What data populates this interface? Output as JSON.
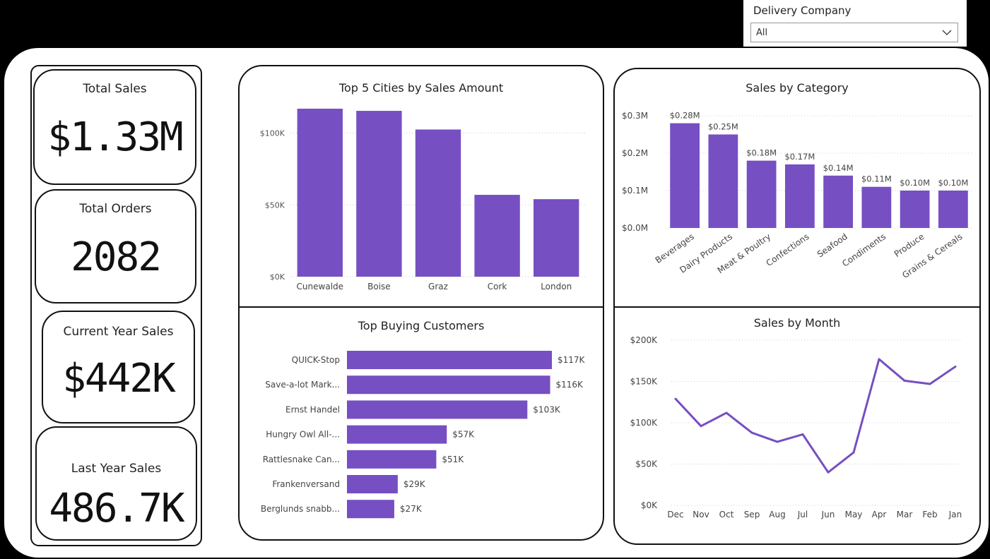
{
  "slicer": {
    "title": "Delivery Company",
    "value": "All"
  },
  "kpis": {
    "total_sales": {
      "label": "Total Sales",
      "value": "$1.33M"
    },
    "total_orders": {
      "label": "Total Orders",
      "value": "2082"
    },
    "current_year_sales": {
      "label": "Current Year Sales",
      "value": "$442K"
    },
    "last_year_sales": {
      "label": "Last Year Sales",
      "value": "486.7K"
    }
  },
  "colors": {
    "accent": "#764FC3"
  },
  "chart_data": [
    {
      "id": "cities",
      "type": "bar",
      "title": "Top 5 Cities by Sales Amount",
      "categories": [
        "Cunewalde",
        "Boise",
        "Graz",
        "Cork",
        "London"
      ],
      "values": [
        117,
        115.5,
        102.5,
        57,
        54
      ],
      "ylim": [
        0,
        117
      ],
      "yticks": [
        0,
        50,
        100
      ],
      "ytick_labels": [
        "$0K",
        "$50K",
        "$100K"
      ],
      "grid": true
    },
    {
      "id": "categories",
      "type": "bar",
      "title": "Sales by Category",
      "categories": [
        "Beverages",
        "Dairy Products",
        "Meat & Poultry",
        "Confections",
        "Seafood",
        "Condiments",
        "Produce",
        "Grains & Cereals"
      ],
      "values": [
        0.28,
        0.25,
        0.18,
        0.17,
        0.14,
        0.11,
        0.1,
        0.1
      ],
      "data_labels": [
        "$0.28M",
        "$0.25M",
        "$0.18M",
        "$0.17M",
        "$0.14M",
        "$0.11M",
        "$0.10M",
        "$0.10M"
      ],
      "ylim": [
        0,
        0.3
      ],
      "yticks": [
        0,
        0.1,
        0.2,
        0.3
      ],
      "ytick_labels": [
        "$0.0M",
        "$0.1M",
        "$0.2M",
        "$0.3M"
      ],
      "grid": true
    },
    {
      "id": "customers",
      "type": "bar",
      "orientation": "horizontal",
      "title": "Top Buying Customers",
      "categories": [
        "QUICK-Stop",
        "Save-a-lot Mark...",
        "Ernst Handel",
        "Hungry Owl All-...",
        "Rattlesnake Can...",
        "Frankenversand",
        "Berglunds snabb..."
      ],
      "values": [
        117,
        116,
        103,
        57,
        51,
        29,
        27
      ],
      "data_labels": [
        "$117K",
        "$116K",
        "$103K",
        "$57K",
        "$51K",
        "$29K",
        "$27K"
      ],
      "xlim": [
        0,
        117
      ]
    },
    {
      "id": "months",
      "type": "line",
      "title": "Sales by Month",
      "x": [
        "Dec",
        "Nov",
        "Oct",
        "Sep",
        "Aug",
        "Jul",
        "Jun",
        "May",
        "Apr",
        "Mar",
        "Feb",
        "Jan"
      ],
      "values": [
        129,
        96,
        112,
        88,
        77,
        86,
        40,
        64,
        177,
        151,
        147,
        168
      ],
      "ylim": [
        0,
        200
      ],
      "yticks": [
        0,
        50,
        100,
        150,
        200
      ],
      "ytick_labels": [
        "$0K",
        "$50K",
        "$100K",
        "$150K",
        "$200K"
      ],
      "grid": true
    }
  ]
}
